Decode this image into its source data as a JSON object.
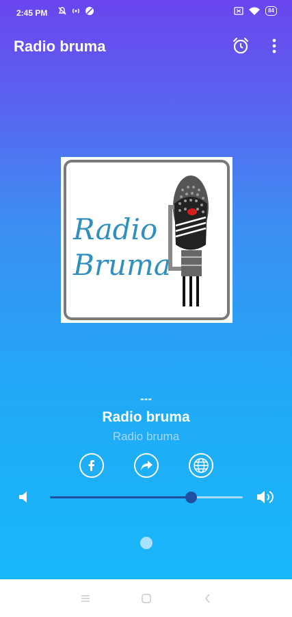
{
  "status_bar": {
    "time": "2:45 PM",
    "battery": "84"
  },
  "app_bar": {
    "title": "Radio bruma"
  },
  "artwork": {
    "line1": "Radio",
    "line2": "Bruma"
  },
  "player": {
    "track_title": "---",
    "station_name": "Radio bruma",
    "station_subtitle": "Radio bruma",
    "volume_fraction": 0.73
  },
  "colors": {
    "slider_accent": "#1e4fa0",
    "slider_track": "#a9d9ff"
  },
  "icons": {
    "facebook": "facebook-icon",
    "share": "share-icon",
    "web": "globe-icon",
    "alarm": "alarm-icon",
    "menu": "more-vert-icon"
  }
}
